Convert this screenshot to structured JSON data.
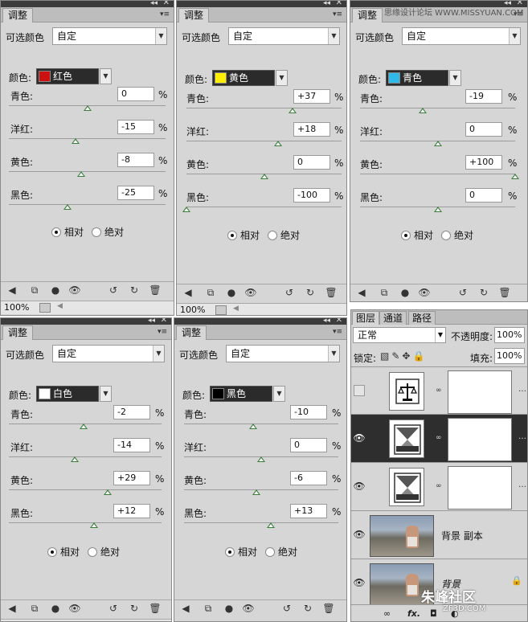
{
  "panels": [
    {
      "tab": "调整",
      "preset_label": "可选颜色",
      "preset_value": "自定",
      "colors_label": "颜色:",
      "color_name": "红色",
      "color_swatch": "#cc1111",
      "sliders": [
        {
          "label": "青色:",
          "value": "0",
          "pct": "%",
          "level": 0
        },
        {
          "label": "洋红:",
          "value": "-15",
          "pct": "%",
          "level": -15
        },
        {
          "label": "黄色:",
          "value": "-8",
          "pct": "%",
          "level": -8
        },
        {
          "label": "黑色:",
          "value": "-25",
          "pct": "%",
          "level": -25
        }
      ],
      "radio_relative": "相对",
      "radio_absolute": "绝对",
      "zoom": "100%"
    },
    {
      "tab": "调整",
      "preset_label": "可选颜色",
      "preset_value": "自定",
      "colors_label": "颜色:",
      "color_name": "黄色",
      "color_swatch": "#ffee00",
      "sliders": [
        {
          "label": "青色:",
          "value": "+37",
          "pct": "%",
          "level": 37
        },
        {
          "label": "洋红:",
          "value": "+18",
          "pct": "%",
          "level": 18
        },
        {
          "label": "黄色:",
          "value": "0",
          "pct": "%",
          "level": 0
        },
        {
          "label": "黑色:",
          "value": "-100",
          "pct": "%",
          "level": -100
        }
      ],
      "radio_relative": "相对",
      "radio_absolute": "绝对",
      "zoom": "100%"
    },
    {
      "tab": "调整",
      "preset_label": "可选颜色",
      "preset_value": "自定",
      "colors_label": "颜色:",
      "color_name": "青色",
      "color_swatch": "#2fb8e8",
      "sliders": [
        {
          "label": "青色:",
          "value": "-19",
          "pct": "%",
          "level": -19
        },
        {
          "label": "洋红:",
          "value": "0",
          "pct": "%",
          "level": 0
        },
        {
          "label": "黄色:",
          "value": "+100",
          "pct": "%",
          "level": 100
        },
        {
          "label": "黑色:",
          "value": "0",
          "pct": "%",
          "level": 0
        }
      ],
      "radio_relative": "相对",
      "radio_absolute": "绝对",
      "zoom": ""
    },
    {
      "tab": "调整",
      "preset_label": "可选颜色",
      "preset_value": "自定",
      "colors_label": "颜色:",
      "color_name": "白色",
      "color_swatch": "#ffffff",
      "sliders": [
        {
          "label": "青色:",
          "value": "-2",
          "pct": "%",
          "level": -2
        },
        {
          "label": "洋红:",
          "value": "-14",
          "pct": "%",
          "level": -14
        },
        {
          "label": "黄色:",
          "value": "+29",
          "pct": "%",
          "level": 29
        },
        {
          "label": "黑色:",
          "value": "+12",
          "pct": "%",
          "level": 12
        }
      ],
      "radio_relative": "相对",
      "radio_absolute": "绝对",
      "zoom": ""
    },
    {
      "tab": "调整",
      "preset_label": "可选颜色",
      "preset_value": "自定",
      "colors_label": "颜色:",
      "color_name": "黑色",
      "color_swatch": "#000000",
      "sliders": [
        {
          "label": "青色:",
          "value": "-10",
          "pct": "%",
          "level": -10
        },
        {
          "label": "洋红:",
          "value": "0",
          "pct": "%",
          "level": 0
        },
        {
          "label": "黄色:",
          "value": "-6",
          "pct": "%",
          "level": -6
        },
        {
          "label": "黑色:",
          "value": "+13",
          "pct": "%",
          "level": 13
        }
      ],
      "radio_relative": "相对",
      "radio_absolute": "绝对",
      "zoom": ""
    }
  ],
  "layers_panel": {
    "tabs": [
      "图层",
      "通道",
      "路径"
    ],
    "blend_mode": "正常",
    "opacity_label": "不透明度:",
    "opacity_value": "100%",
    "lock_label": "锁定:",
    "fill_label": "填充:",
    "fill_value": "100%",
    "layers": [
      {
        "name": "",
        "kind": "balance-adjustment",
        "visible": false,
        "selected": false
      },
      {
        "name": "",
        "kind": "selective-color-adjustment",
        "visible": true,
        "selected": true
      },
      {
        "name": "",
        "kind": "selective-color-adjustment",
        "visible": true,
        "selected": false
      },
      {
        "name": "背景 副本",
        "kind": "photo",
        "visible": true,
        "selected": false
      },
      {
        "name": "背景",
        "kind": "photo",
        "visible": true,
        "selected": false,
        "locked": true
      }
    ],
    "bottom_fx": "fx."
  },
  "watermark": "思缘设计论坛  WWW.MISSYUAN.COM",
  "logo": "朱峰社区",
  "logo_sub": "ZF3D.COM"
}
